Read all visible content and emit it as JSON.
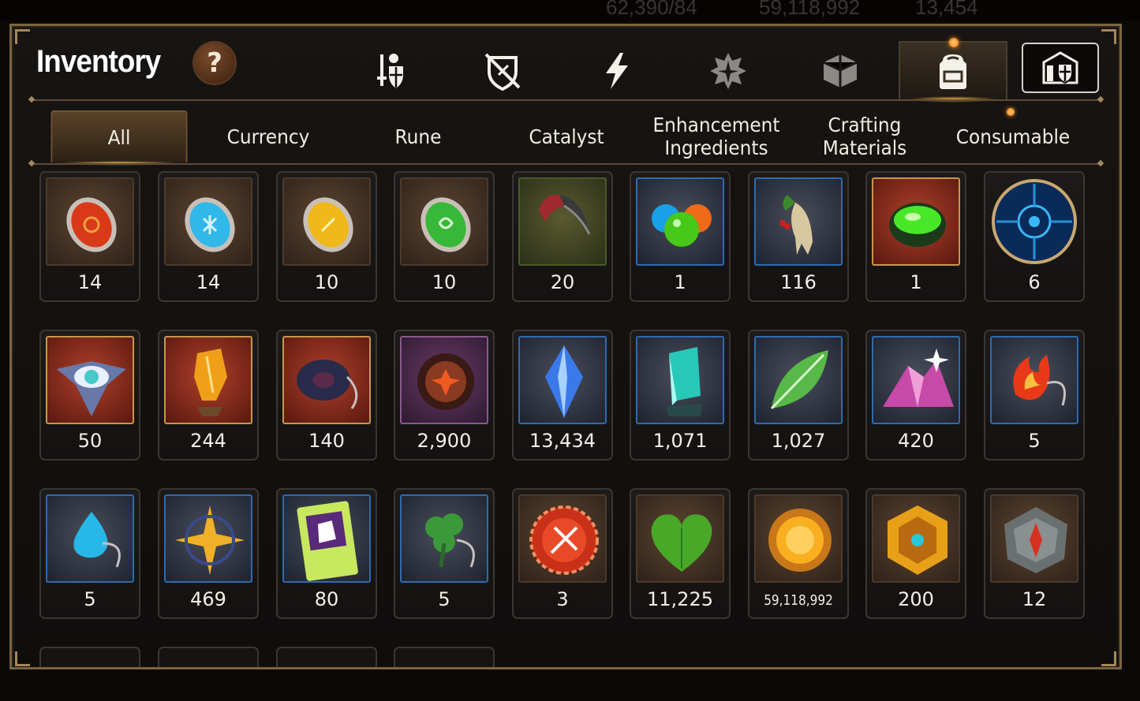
{
  "window": {
    "title": "Inventory",
    "help_label": "?"
  },
  "top_bar": {
    "ghost_text_1": "62,390/84",
    "ghost_text_2": "59,118,992",
    "ghost_text_3": "13,454"
  },
  "category_tabs": [
    {
      "icon": "sword-shield-icon"
    },
    {
      "icon": "broken-shield-icon"
    },
    {
      "icon": "lightning-icon"
    },
    {
      "icon": "gear-star-icon"
    },
    {
      "icon": "cube-icon"
    },
    {
      "icon": "backpack-icon",
      "selected": true
    },
    {
      "icon": "castle-shield-icon"
    }
  ],
  "sub_tabs": [
    "All",
    "Currency",
    "Rune",
    "Catalyst",
    "Enhancement Ingredients",
    "Crafting Materials",
    "Consumable"
  ],
  "active_sub_tab": "All",
  "items": [
    {
      "name": "red-rune-coin",
      "count": "14"
    },
    {
      "name": "blue-rune-coin",
      "count": "14"
    },
    {
      "name": "yellow-rune-coin",
      "count": "10"
    },
    {
      "name": "green-rune-coin",
      "count": "10"
    },
    {
      "name": "claw",
      "count": "20"
    },
    {
      "name": "slime-orbs",
      "count": "1"
    },
    {
      "name": "ginseng-root",
      "count": "116"
    },
    {
      "name": "green-potion-bowl",
      "count": "1"
    },
    {
      "name": "blue-sigil-orb",
      "count": "6"
    },
    {
      "name": "eye-emblem",
      "count": "50"
    },
    {
      "name": "amber-crystal",
      "count": "244"
    },
    {
      "name": "dark-ring-pendant",
      "count": "140"
    },
    {
      "name": "flower-ring",
      "count": "2,900"
    },
    {
      "name": "blue-crystal-shard",
      "count": "13,434"
    },
    {
      "name": "teal-crystal",
      "count": "1,071"
    },
    {
      "name": "green-leaf",
      "count": "1,027"
    },
    {
      "name": "pink-ore",
      "count": "420"
    },
    {
      "name": "flame-charm",
      "count": "5"
    },
    {
      "name": "water-charm",
      "count": "5"
    },
    {
      "name": "star-charm",
      "count": "469"
    },
    {
      "name": "costume-card",
      "count": "80"
    },
    {
      "name": "clover-charm",
      "count": "5"
    },
    {
      "name": "sword-badge",
      "count": "3"
    },
    {
      "name": "green-heart",
      "count": "11,225"
    },
    {
      "name": "gold-coin",
      "count": "59,118,992"
    },
    {
      "name": "gold-shield-emblem",
      "count": "200"
    },
    {
      "name": "stone-compass",
      "count": "12"
    }
  ]
}
